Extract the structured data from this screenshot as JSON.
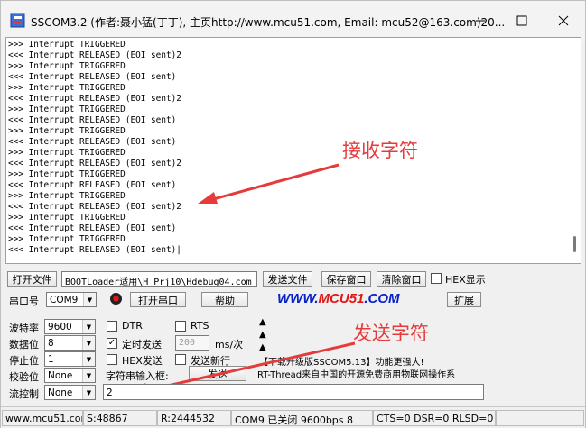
{
  "window": {
    "title": "SSCOM3.2 (作者:聂小猛(丁丁), 主页http://www.mcu51.com,  Email: mcu52@163.com)20...",
    "min_icon": "minimize-icon",
    "max_icon": "maximize-icon",
    "close_icon": "close-icon"
  },
  "terminal": {
    "lines": [
      ">>> Interrupt TRIGGERED",
      "<<< Interrupt RELEASED (EOI sent)2",
      ">>> Interrupt TRIGGERED",
      "<<< Interrupt RELEASED (EOI sent)",
      ">>> Interrupt TRIGGERED",
      "<<< Interrupt RELEASED (EOI sent)2",
      ">>> Interrupt TRIGGERED",
      "<<< Interrupt RELEASED (EOI sent)",
      ">>> Interrupt TRIGGERED",
      "<<< Interrupt RELEASED (EOI sent)",
      ">>> Interrupt TRIGGERED",
      "<<< Interrupt RELEASED (EOI sent)2",
      ">>> Interrupt TRIGGERED",
      "<<< Interrupt RELEASED (EOI sent)",
      ">>> Interrupt TRIGGERED",
      "<<< Interrupt RELEASED (EOI sent)2",
      ">>> Interrupt TRIGGERED",
      "<<< Interrupt RELEASED (EOI sent)",
      ">>> Interrupt TRIGGERED",
      "<<< Interrupt RELEASED (EOI sent)|"
    ]
  },
  "annotations": {
    "receive": "接收字符",
    "send": "发送字符",
    "color": "#e53b3b"
  },
  "toolbar1": {
    "open_file": "打开文件",
    "file_path": "BOOTLoader适用\\H_Prj10\\Hdebug04.com",
    "send_file": "发送文件",
    "save_window": "保存窗口",
    "clear_window": "清除窗口",
    "hex_display": "HEX显示"
  },
  "toolbar2": {
    "port_label": "串口号",
    "port_value": "COM9",
    "open_port": "打开串口",
    "help": "帮助",
    "logo_prefix": "WWW.",
    "logo_brand": "MCU51",
    "logo_suffix": ".COM",
    "expand": "扩展"
  },
  "settings": {
    "baud_label": "波特率",
    "baud_value": "9600",
    "databits_label": "数据位",
    "databits_value": "8",
    "stopbits_label": "停止位",
    "stopbits_value": "1",
    "parity_label": "校验位",
    "parity_value": "None",
    "flow_label": "流控制",
    "flow_value": "None"
  },
  "options": {
    "dtr": "DTR",
    "rts": "RTS",
    "timed_send": "定时发送",
    "interval_value": "200",
    "interval_unit": "ms/次",
    "hex_send": "HEX发送",
    "newline": "发送新行",
    "input_label": "字符串输入框:",
    "send_button": "发送",
    "input_value": "2"
  },
  "info": {
    "line1": "【下载升级版SSCOM5.13】功能更强大!",
    "line2": "RT-Thread来自中国的开源免费商用物联网操作系"
  },
  "statusbar": {
    "site": "www.mcu51.cor",
    "sent": "S:48867",
    "received": "R:2444532",
    "port_state": "COM9 已关闭  9600bps  8",
    "signals": "CTS=0 DSR=0 RLSD=0"
  }
}
